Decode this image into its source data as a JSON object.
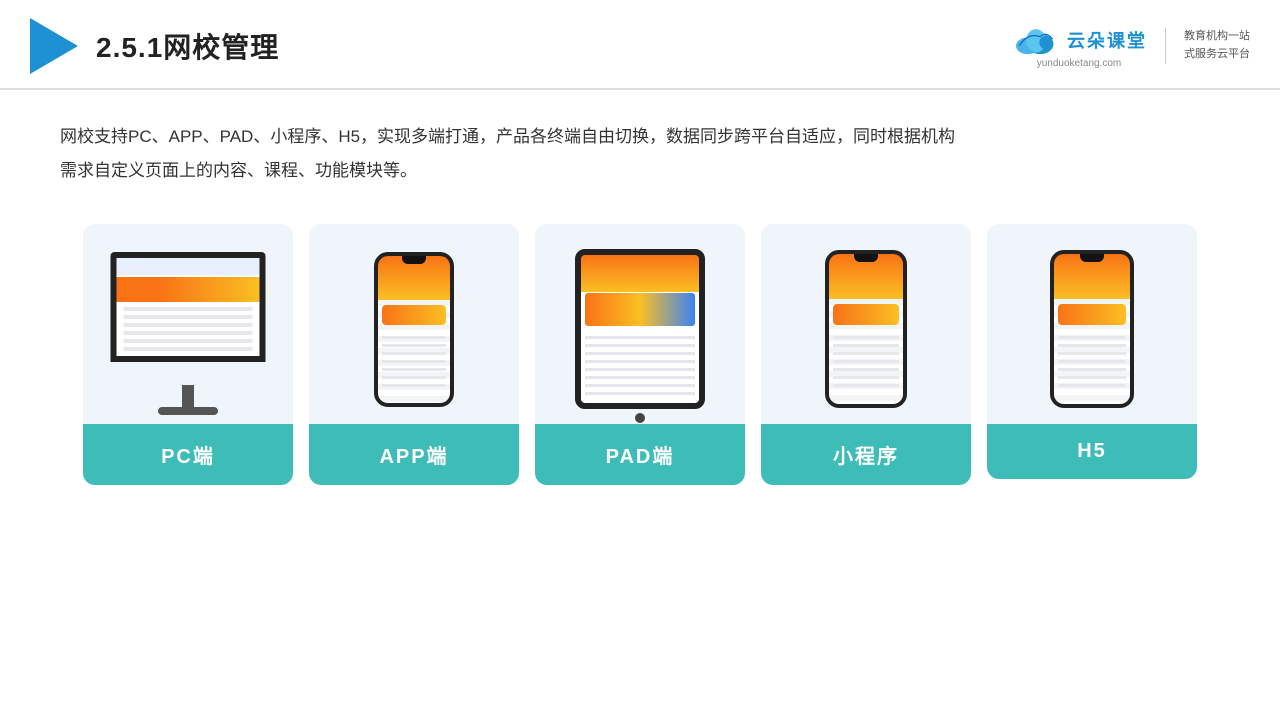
{
  "header": {
    "title": "2.5.1网校管理",
    "brand": {
      "name": "云朵课堂",
      "url": "yunduoketang.com",
      "slogan_line1": "教育机构一站",
      "slogan_line2": "式服务云平台"
    }
  },
  "main": {
    "description": "网校支持PC、APP、PAD、小程序、H5，实现多端打通，产品各终端自由切换，数据同步跨平台自适应，同时根据机构\n需求自定义页面上的内容、课程、功能模块等。",
    "cards": [
      {
        "id": "pc",
        "label": "PC端"
      },
      {
        "id": "app",
        "label": "APP端"
      },
      {
        "id": "pad",
        "label": "PAD端"
      },
      {
        "id": "mini",
        "label": "小程序"
      },
      {
        "id": "h5",
        "label": "H5"
      }
    ]
  }
}
